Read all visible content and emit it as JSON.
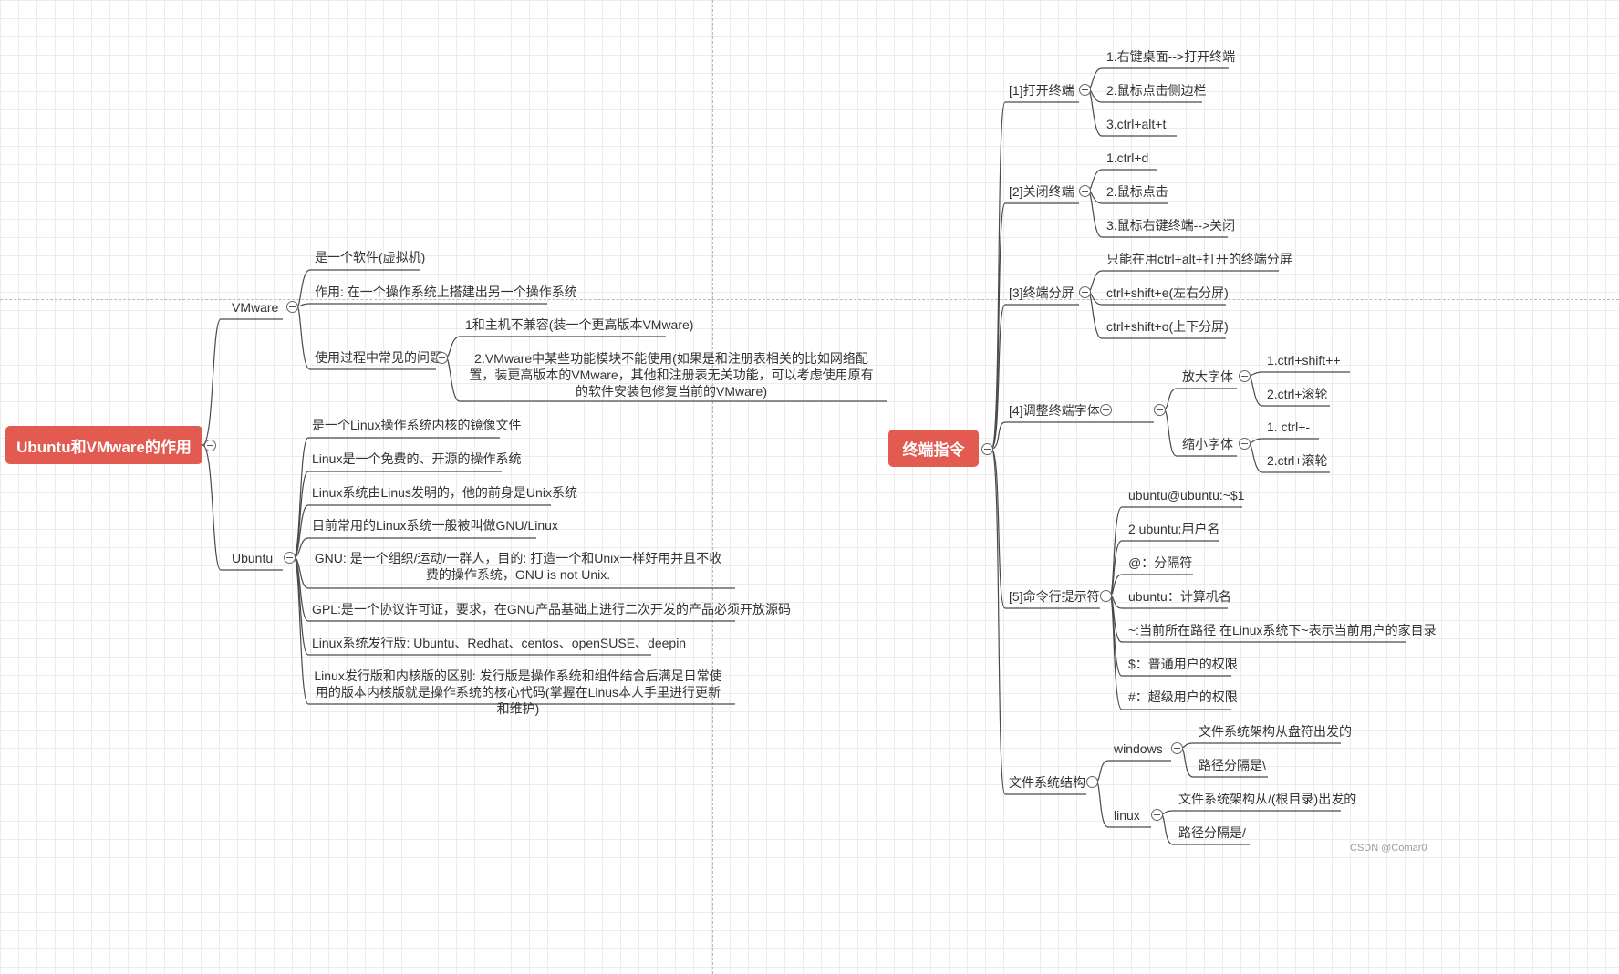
{
  "left": {
    "root": "Ubuntu和VMware的作用",
    "vmware": {
      "label": "VMware",
      "items": [
        "是一个软件(虚拟机)",
        "作用: 在一个操作系统上搭建出另一个操作系统"
      ],
      "problems": {
        "label": "使用过程中常见的问题",
        "items": [
          "1和主机不兼容(装一个更高版本VMware)",
          "2.VMware中某些功能模块不能使用(如果是和注册表相关的比如网络配置，装更高版本的VMware，其他和注册表无关功能，可以考虑使用原有的软件安装包修复当前的VMware)"
        ]
      }
    },
    "ubuntu": {
      "label": "Ubuntu",
      "items": [
        "是一个Linux操作系统内核的镜像文件",
        "Linux是一个免费的、开源的操作系统",
        "Linux系统由Linus发明的，他的前身是Unix系统",
        "目前常用的Linux系统一般被叫做GNU/Linux",
        "GNU: 是一个组织/运动/一群人，目的: 打造一个和Unix一样好用并且不收费的操作系统，GNU is not Unix.",
        "GPL:是一个协议许可证，要求，在GNU产品基础上进行二次开发的产品必须开放源码",
        "Linux系统发行版: Ubuntu、Redhat、centos、openSUSE、deepin",
        "Linux发行版和内核版的区别: 发行版是操作系统和组件结合后满足日常使用的版本内核版就是操作系统的核心代码(掌握在Linus本人手里进行更新和维护)"
      ]
    }
  },
  "right": {
    "root": "终端指令",
    "open": {
      "label": "[1]打开终端",
      "items": [
        "1.右键桌面-->打开终端",
        "2.鼠标点击侧边栏",
        "3.ctrl+alt+t"
      ]
    },
    "close": {
      "label": "[2]关闭终端",
      "items": [
        "1.ctrl+d",
        "2.鼠标点击",
        "3.鼠标右键终端-->关闭"
      ]
    },
    "split": {
      "label": "[3]终端分屏",
      "items": [
        "只能在用ctrl+alt+打开的终端分屏",
        "ctrl+shift+e(左右分屏)",
        "ctrl+shift+o(上下分屏)"
      ]
    },
    "font": {
      "label": "[4]调整终端字体",
      "enlarge": {
        "label": "放大字体",
        "items": [
          "1.ctrl+shift++",
          "2.ctrl+滚轮"
        ]
      },
      "shrink": {
        "label": "缩小字体",
        "items": [
          "1. ctrl+-",
          "2.ctrl+滚轮"
        ]
      }
    },
    "prompt": {
      "label": "[5]命令行提示符",
      "items": [
        "ubuntu@ubuntu:~$1",
        "2 ubuntu:用户名",
        "@：分隔符",
        "ubuntu：计算机名",
        "~:当前所在路径  在Linux系统下~表示当前用户的家目录",
        "$：普通用户的权限",
        "#：超级用户的权限"
      ]
    },
    "fs": {
      "label": "文件系统结构",
      "windows": {
        "label": "windows",
        "items": [
          "文件系统架构从盘符出发的",
          "路径分隔是\\"
        ]
      },
      "linux": {
        "label": "linux",
        "items": [
          "文件系统架构从/(根目录)出发的",
          "路径分隔是/"
        ]
      }
    }
  },
  "watermark": "CSDN @Comar0",
  "colors": {
    "root": "#e25a50",
    "line": "#4a4a4a",
    "grid": "#ececec"
  }
}
